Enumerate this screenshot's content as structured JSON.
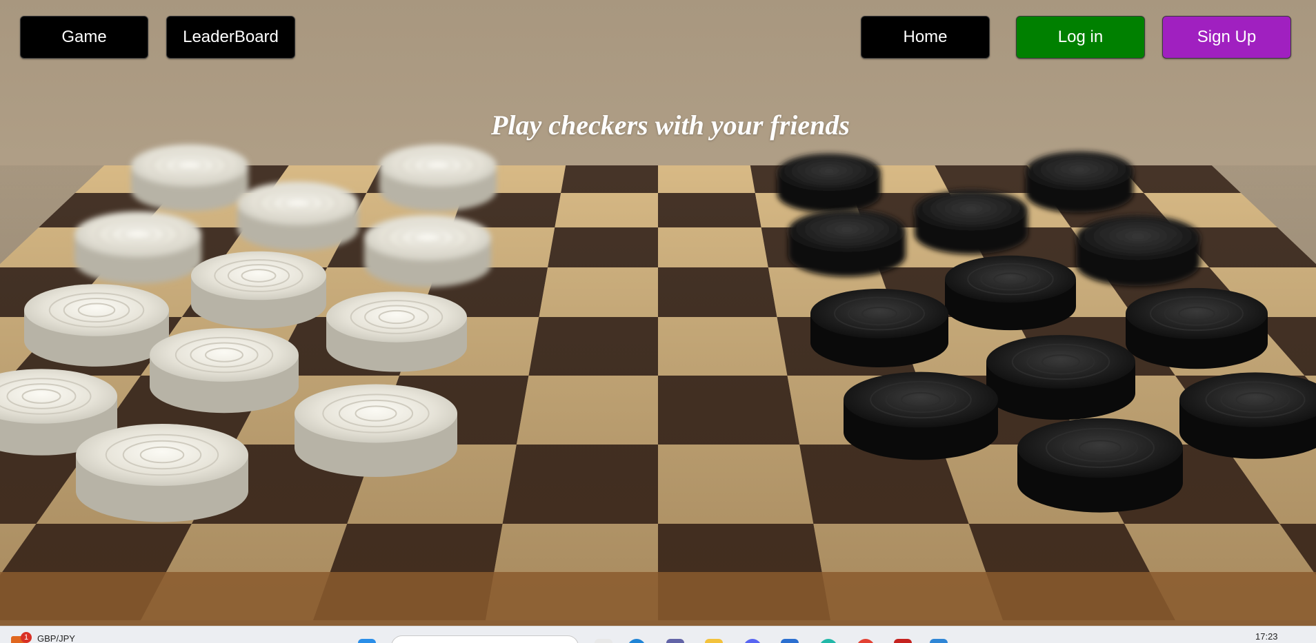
{
  "nav": {
    "game": "Game",
    "leaderboard": "LeaderBoard",
    "home": "Home",
    "login": "Log in",
    "signup": "Sign Up"
  },
  "hero": {
    "tagline": "Play checkers with your friends"
  },
  "taskbar": {
    "ticker_badge": "1",
    "ticker_label": "GBP/JPY",
    "clock": "17:23"
  },
  "colors": {
    "nav_default": "#000000",
    "login": "#008000",
    "signup": "#a020c0",
    "tagline": "#ffffff",
    "board_light": "#e3c38c",
    "board_dark": "#4a372a",
    "piece_white": "#e9e6dc",
    "piece_black": "#1c1c1c"
  },
  "icons": [
    "windows-start-icon",
    "search-icon",
    "file-icon",
    "edge-icon",
    "teams-icon",
    "folder-icon",
    "discord-icon",
    "store-icon",
    "browser-icon",
    "chrome-icon",
    "gmail-icon",
    "vscode-icon"
  ]
}
